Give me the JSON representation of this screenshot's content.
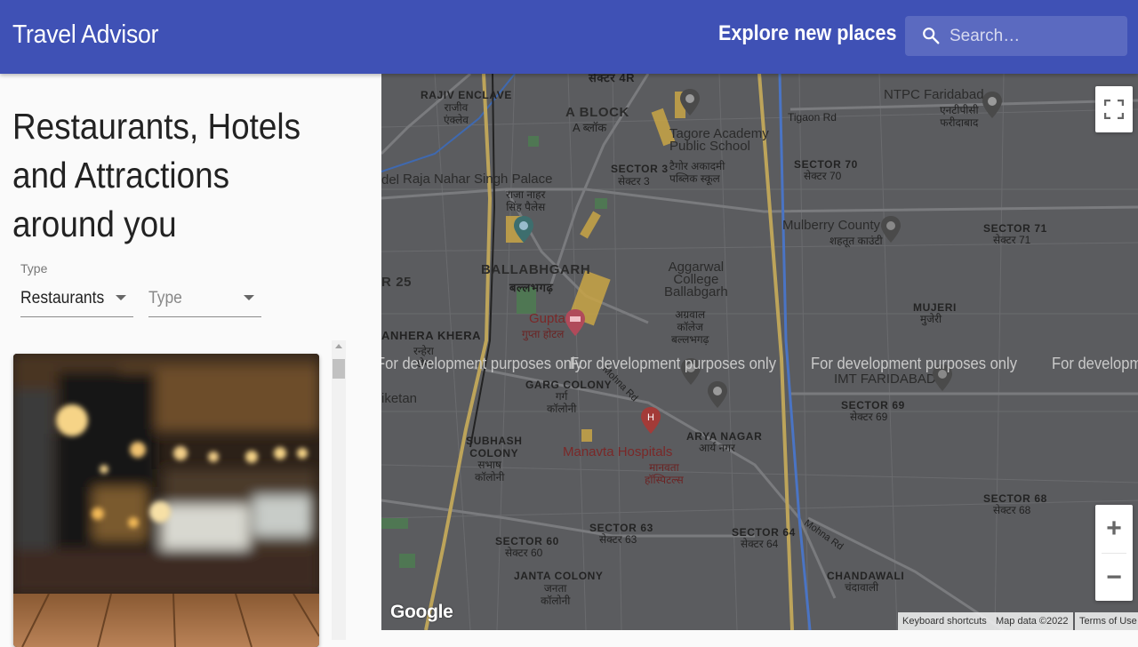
{
  "header": {
    "title": "Travel Advisor",
    "explore": "Explore new places",
    "search_placeholder": "Search…"
  },
  "list": {
    "heading": "Restaurants, Hotels and Attractions around you",
    "type_label": "Type",
    "selects": [
      {
        "value": "Restaurants"
      },
      {
        "value": "Type"
      }
    ]
  },
  "map": {
    "dev_watermark": "For development purposes only",
    "labels": {
      "sector4r": "सेक्टर 4R",
      "rajiv": "RAJIV ENCLAVE",
      "rajiv_hi": "राजीव\nएंक्लेव",
      "ablock": "A BLOCK",
      "ablock_hi": "A ब्लॉक",
      "tagore": "Tagore Academy\nPublic School",
      "tagore_hi": "टैगोर अकादमी\nपब्लिक स्कूल",
      "sector3": "SECTOR 3",
      "sector3_hi": "सेक्टर 3",
      "del": "del",
      "rajanahar": "Raja Nahar Singh Palace",
      "rajanahar_hi": "राजा नाहर\nसिंह पैलेस",
      "ballabhgarh": "BALLABHGARH",
      "ballabhgarh_hi": "बल्लभगढ़",
      "aggarwal": "Aggarwal\nCollege\nBallabgarh",
      "aggarwal_hi": "अग्रवाल\nकॉलेज\nबल्लभगढ़",
      "r25": "R 25",
      "gupta": "Gupta",
      "gupta_hi": "गुप्ता होटल",
      "anhera": "ANHERA KHERA",
      "anhera_hi": "रन्हेरा\nखेरा",
      "garg": "GARG COLONY",
      "garg_hi": "गर्ग\nकॉलोनी",
      "iketan": "iketan",
      "subhash": "SUBHASH\nCOLONY",
      "subhash_hi": "सभाष\nकॉलोनी",
      "manavta": "Manavta Hospitals",
      "manavta_hi": "मानवता\nहॉस्पिटल्स",
      "arya": "ARYA NAGAR",
      "arya_hi": "आर्य नगर",
      "mohna": "Mohna Rd",
      "mohna2": "Mohna Rd",
      "ntpc": "NTPC Faridabad",
      "ntpc_hi": "एनटीपीसी\nफरीदाबाद",
      "tigaon": "Tigaon Rd",
      "sector70": "SECTOR 70",
      "sector70_hi": "सेक्टर 70",
      "mulberry": "Mulberry County",
      "mulberry_hi": "शहतूत काउंटी",
      "sector71": "SECTOR 71",
      "sector71_hi": "सेक्टर 71",
      "mujeri": "MUJERI",
      "mujeri_hi": "मुजेरी",
      "imt": "IMT FARIDABAD",
      "sector69": "SECTOR 69",
      "sector69_hi": "सेक्टर 69",
      "sector68": "SECTOR 68",
      "sector68_hi": "सेक्टर 68",
      "sector60": "SECTOR 60",
      "sector60_hi": "सेक्टर 60",
      "sector63": "SECTOR 63",
      "sector63_hi": "सेक्टर 63",
      "sector64": "SECTOR 64",
      "sector64_hi": "सेक्टर 64",
      "janta": "JANTA COLONY",
      "janta_hi": "जनता\nकॉलोनी",
      "chandawali": "CHANDAWALI",
      "chandawali_hi": "चंदावाली"
    },
    "google": "Google",
    "keyboard": "Keyboard shortcuts",
    "mapdata": "Map data ©2022",
    "terms": "Terms of Use",
    "zoom_in": "+",
    "zoom_out": "−"
  }
}
